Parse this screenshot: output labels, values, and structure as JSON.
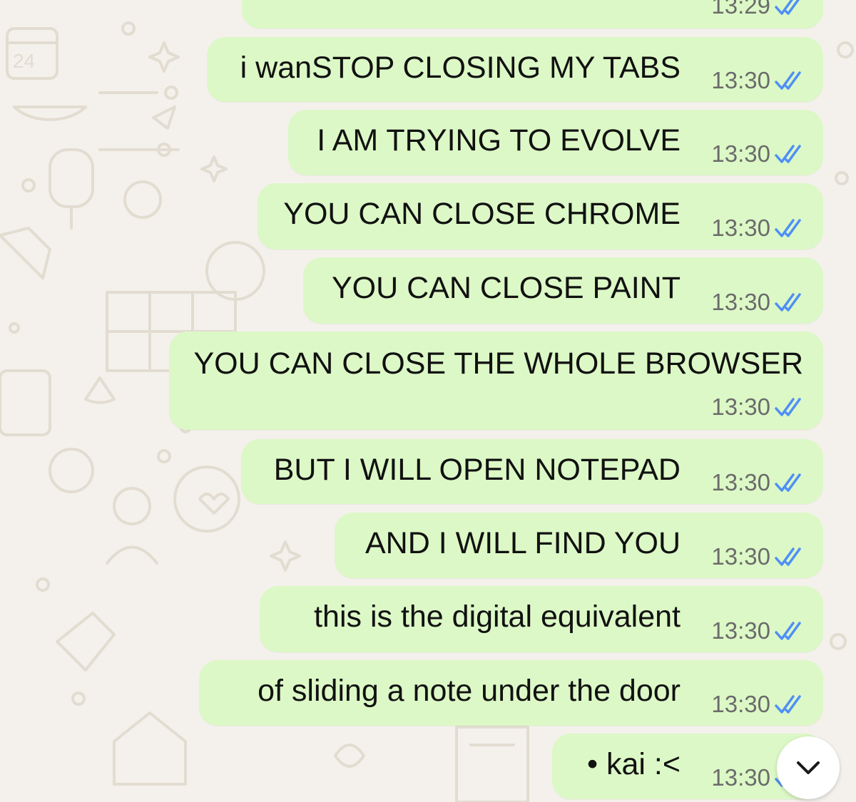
{
  "colors": {
    "background": "#f4f1ec",
    "doodle": "#e2dcd1",
    "bubble": "#dcf8c6",
    "tick": "#4f8ff7",
    "time": "#6b6b6b"
  },
  "chat": {
    "partial_top_time": "13:29",
    "messages": [
      {
        "text": "i wanSTOP CLOSING MY TABS",
        "time": "13:30",
        "status": "read-ticks-icon"
      },
      {
        "text": "I AM TRYING TO EVOLVE",
        "time": "13:30",
        "status": "read-ticks-icon"
      },
      {
        "text": "YOU CAN CLOSE CHROME",
        "time": "13:30",
        "status": "read-ticks-icon"
      },
      {
        "text": "YOU CAN CLOSE PAINT",
        "time": "13:30",
        "status": "read-ticks-icon"
      },
      {
        "text": "YOU CAN CLOSE THE WHOLE BROWSER",
        "time": "13:30",
        "status": "read-ticks-icon"
      },
      {
        "text": "BUT I WILL OPEN NOTEPAD",
        "time": "13:30",
        "status": "read-ticks-icon"
      },
      {
        "text": "AND I WILL FIND YOU",
        "time": "13:30",
        "status": "read-ticks-icon"
      },
      {
        "text": "this is the digital equivalent",
        "time": "13:30",
        "status": "read-ticks-icon"
      },
      {
        "text": "of sliding a note under the door",
        "time": "13:30",
        "status": "read-ticks-icon"
      },
      {
        "text": "• kai :<",
        "time": "13:30",
        "status": "read-ticks-icon"
      }
    ]
  },
  "controls": {
    "scroll_down_icon": "chevron-down-icon"
  }
}
